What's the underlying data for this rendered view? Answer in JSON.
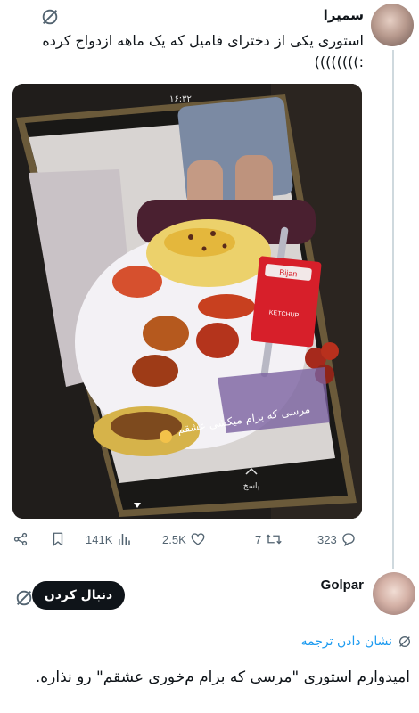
{
  "post": {
    "username": "سمیرا",
    "text": "استوری یکی از دخترای فامیل که یک ماهه ازدواج کرده :))))))))",
    "media": {
      "phone_time": "۱۶:۳۲",
      "story_caption": "مرسی که برام میکشی عشقم",
      "story_reply_label": "پاسخ",
      "ketchup_brand": "Bijan",
      "ketchup_label": "KETCHUP"
    },
    "stats": {
      "views": "141K",
      "likes": "2.5K",
      "reposts": "7",
      "comments": "323"
    }
  },
  "reply": {
    "username": "Golpar",
    "follow_label": "دنبال کردن",
    "translate_label": "نشان دادن ترجمه",
    "text": "امیدوارم استوری \"مرسی که برام م‌خوری عشقم\" رو نذاره."
  },
  "icons": {
    "share": "share-icon",
    "bookmark": "bookmark-icon",
    "views": "views-icon",
    "like": "heart-icon",
    "repost": "repost-icon",
    "comment": "comment-icon",
    "grok": "grok-icon",
    "globe": "globe-icon"
  },
  "colors": {
    "text": "#0f1419",
    "secondary": "#536471",
    "link": "#1d9bf0",
    "button": "#0f1419"
  }
}
